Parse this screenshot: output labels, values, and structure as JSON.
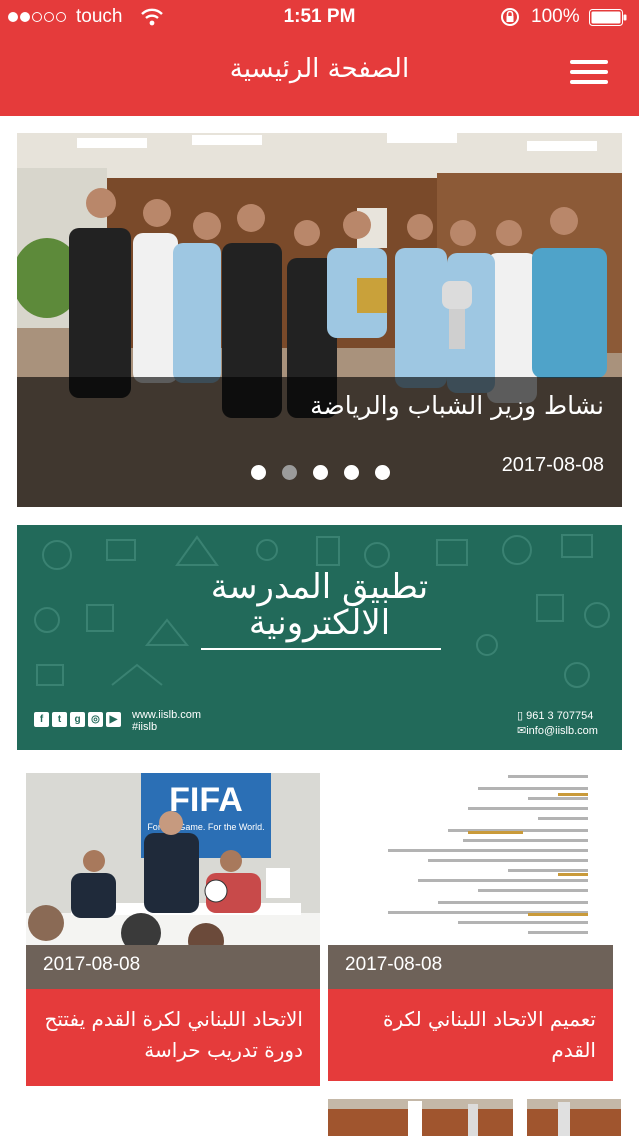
{
  "status_bar": {
    "carrier": "touch",
    "time": "1:51 PM",
    "battery": "100%",
    "signal_bars_filled": 2,
    "signal_bars_total": 5
  },
  "header": {
    "title": "الصفحة الرئيسية",
    "menu_icon": "hamburger-menu-icon"
  },
  "hero": {
    "title": "نشاط وزير الشباب والرياضة",
    "date": "2017-08-08",
    "slide_count": 5,
    "active_slide_index": 1
  },
  "banner": {
    "title_line1": "تطبيق المدرسة",
    "title_line2": "الالكترونية",
    "website": "www.iislb.com",
    "hashtag": "#iislb",
    "phone": "961 3 707754",
    "email": "info@iislb.com",
    "social_icons": [
      "facebook-icon",
      "twitter-icon",
      "google-plus-icon",
      "instagram-icon",
      "youtube-icon"
    ]
  },
  "news": [
    {
      "date": "2017-08-08",
      "title": "الاتحاد اللبناني لكرة القدم يفتتح دورة تدريب حراسة",
      "image_text_banner": "FIFA",
      "image_text_slogan": "For the Game. For the World."
    },
    {
      "date": "2017-08-08",
      "title": "تعميم الاتحاد اللبناني لكرة القدم"
    }
  ],
  "colors": {
    "brand_red": "#e53b3b",
    "date_bar": "#6e6259",
    "banner_green": "#226a5a"
  }
}
